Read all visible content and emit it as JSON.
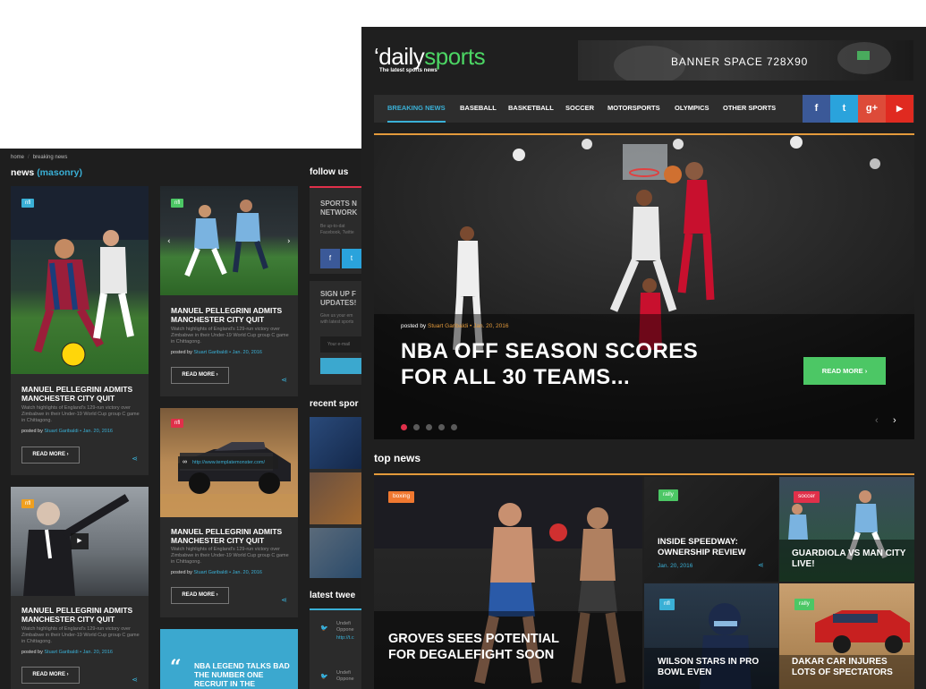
{
  "left_screen": {
    "breadcrumb": [
      "home",
      "breaking news"
    ],
    "title_main": "news",
    "title_highlight": "(masonry)",
    "cards": [
      {
        "badge": "nfl",
        "badge_color": "#3ab0d6",
        "title": "MANUEL PELLEGRINI ADMITS MANCHESTER CITY QUIT",
        "excerpt": "Watch highlights of England's 129-run victory over Zimbabwe in their Under-19 World Cup group C game in Chittagong.",
        "posted_by": "posted by",
        "author": "Stuart Garibaldi",
        "date": "Jan. 20, 2016",
        "read_more": "READ MORE"
      },
      {
        "badge": "nfl",
        "badge_color": "#4cc765",
        "title": "MANUEL PELLEGRINI ADMITS MANCHESTER CITY QUIT",
        "excerpt": "Watch highlights of England's 129-run victory over Zimbabwe in their Under-19 World Cup group C game in Chittagong.",
        "posted_by": "posted by",
        "author": "Stuart Garibaldi",
        "date": "Jan. 20, 2016",
        "read_more": "READ MORE"
      },
      {
        "badge": "nfl",
        "badge_color": "#e0304a",
        "link": "http://www.templatemonster.com/",
        "title": "MANUEL PELLEGRINI ADMITS MANCHESTER CITY QUIT",
        "excerpt": "Watch highlights of England's 129-run victory over Zimbabwe in their Under-19 World Cup group C game in Chittagong.",
        "posted_by": "posted by",
        "author": "Stuart Garibaldi",
        "date": "Jan. 20, 2016",
        "read_more": "READ MORE"
      },
      {
        "badge": "nfl",
        "badge_color": "#f0a020",
        "title": "MANUEL PELLEGRINI ADMITS MANCHESTER CITY QUIT",
        "excerpt": "Watch highlights of England's 129-run victory over Zimbabwe in their Under-19 World Cup group C game in Chittagong.",
        "posted_by": "posted by",
        "author": "Stuart Garibaldi",
        "date": "Jan. 20, 2016",
        "read_more": "READ MORE"
      }
    ],
    "quote": "NBA LEGEND TALKS BAD THE NUMBER ONE RECRUIT IN THE",
    "sidebar": {
      "follow_us": "follow us",
      "sports_network": "SPORTS N NETWORK",
      "sports_network_desc": "Be up-to-dat Facebook, Twitte",
      "signup": "SIGN UP F UPDATES!",
      "signup_desc": "Give us your em with latest sports",
      "email_placeholder": "Your e-mail",
      "recent": "recent spor",
      "tweets": "latest twee",
      "tweet1": "Undefi Oppone",
      "tweet1_link": "http://t.c",
      "tweet2": "Undefi Oppone"
    }
  },
  "right_screen": {
    "logo_quote": "‘",
    "logo_part1": "daily",
    "logo_part2": "sports",
    "tagline": "The latest sports news",
    "banner": "BANNER SPACE 728X90",
    "nav": [
      "BREAKING NEWS",
      "BASEBALL",
      "BASKETBALL",
      "SOCCER",
      "MOTORSPORTS",
      "OLYMPICS",
      "OTHER SPORTS"
    ],
    "social": [
      {
        "icon": "facebook-icon",
        "glyph": "f",
        "color": "#3b5998"
      },
      {
        "icon": "twitter-icon",
        "glyph": "t",
        "color": "#2aa3dc"
      },
      {
        "icon": "google-plus-icon",
        "glyph": "g+",
        "color": "#dd4b39"
      },
      {
        "icon": "youtube-icon",
        "glyph": "▶",
        "color": "#e02a20"
      }
    ],
    "hero": {
      "posted_by": "posted by",
      "author": "Stuart Garibaldi",
      "date": "Jan. 20, 2016",
      "title": "NBA OFF SEASON SCORES FOR ALL 30 TEAMS...",
      "read_more": "READ MORE",
      "slides": 5,
      "active_slide": 1
    },
    "top_news_title": "top news",
    "top_news": [
      {
        "badge": "boxing",
        "badge_color": "#f07830",
        "title": "GROVES SEES POTENTIAL FOR DEGALEFIGHT SOON"
      },
      {
        "badge": "rally",
        "badge_color": "#4cc765",
        "title": "INSIDE SPEEDWAY: OWNERSHIP REVIEW",
        "date": "Jan. 20, 2016"
      },
      {
        "badge": "soccer",
        "badge_color": "#e0304a",
        "title": "GUARDIOLA VS MAN CITY LIVE!"
      },
      {
        "badge": "nfl",
        "badge_color": "#3ab0d6",
        "title": "WILSON STARS IN PRO BOWL EVEN"
      },
      {
        "badge": "rally",
        "badge_color": "#4cc765",
        "title": "DAKAR CAR INJURES LOTS OF SPECTATORS"
      }
    ]
  }
}
